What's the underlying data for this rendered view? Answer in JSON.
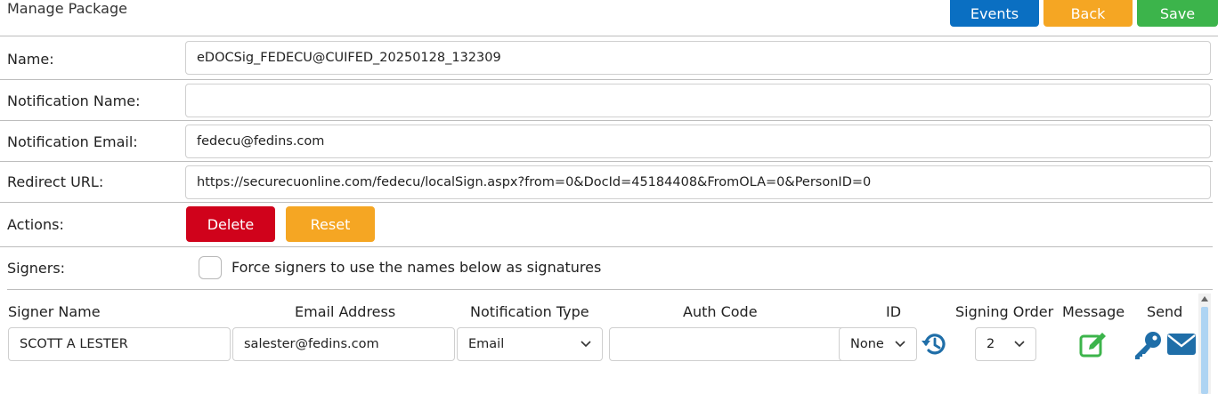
{
  "page": {
    "title": "Manage Package"
  },
  "toolbar": {
    "events_label": "Events",
    "back_label": "Back",
    "save_label": "Save"
  },
  "form": {
    "name_label": "Name:",
    "name_value": "eDOCSig_FEDECU@CUIFED_20250128_132309",
    "notification_name_label": "Notification Name:",
    "notification_name_value": "",
    "notification_email_label": "Notification Email:",
    "notification_email_value": "fedecu@fedins.com",
    "redirect_url_label": "Redirect URL:",
    "redirect_url_value": "https://securecuonline.com/fedecu/localSign.aspx?from=0&DocId=45184408&FromOLA=0&PersonID=0",
    "actions_label": "Actions:",
    "delete_label": "Delete",
    "reset_label": "Reset",
    "signers_label": "Signers:",
    "force_signers_label": "Force signers to use the names below as signatures",
    "force_signers_checked": false
  },
  "signers_table": {
    "headers": {
      "signer_name": "Signer Name",
      "email_address": "Email Address",
      "notification_type": "Notification Type",
      "auth_code": "Auth Code",
      "id": "ID",
      "signing_order": "Signing Order",
      "message": "Message",
      "send": "Send"
    },
    "rows": [
      {
        "signer_name": "SCOTT A LESTER",
        "email_address": "salester@fedins.com",
        "notification_type": "Email",
        "auth_code": "",
        "id": "None",
        "signing_order": "2"
      }
    ]
  },
  "colors": {
    "events": "#0a6fc2",
    "back": "#f5a623",
    "save": "#3cb44b",
    "delete": "#d0021b",
    "reset": "#f5a623",
    "icon_blue": "#1f6ea8",
    "icon_green": "#3cb44b"
  }
}
